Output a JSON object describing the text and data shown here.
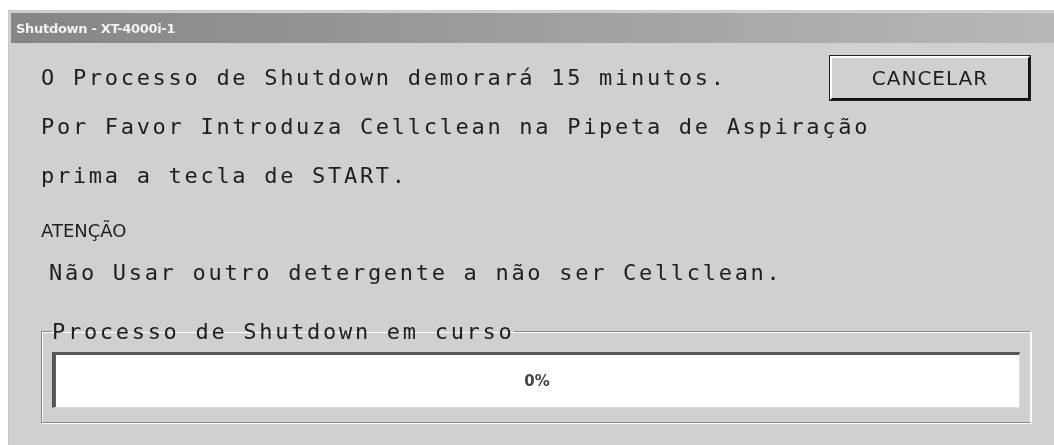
{
  "window": {
    "title": "Shutdown - XT-4000i-1"
  },
  "message_lines": [
    "O Processo de Shutdown demorará 15 minutos.",
    "Por Favor Introduza Cellclean na Pipeta de Aspiração",
    "prima a tecla de START."
  ],
  "cancel_button": {
    "label": "CANCELAR"
  },
  "attention": {
    "heading": "ATENÇÃO",
    "text": "Não Usar outro detergente a não ser Cellclean."
  },
  "progress_group": {
    "label": "Processo de Shutdown em curso",
    "level": 0,
    "reading": "0%"
  }
}
